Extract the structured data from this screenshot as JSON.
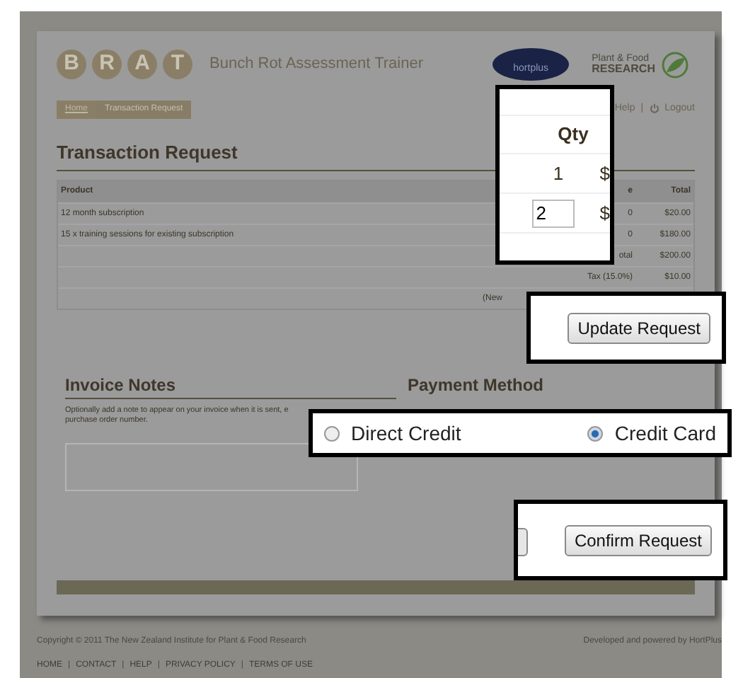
{
  "header": {
    "logo_letters": [
      "B",
      "R",
      "A",
      "T"
    ],
    "tagline": "Bunch Rot Assessment Trainer",
    "partner_logo": "hortplus",
    "partner_name": "Plant & Food",
    "partner_name_2": "RESEARCH"
  },
  "breadcrumb": [
    {
      "label": "Home",
      "selected": false
    },
    {
      "label": "Transaction Request",
      "selected": true
    }
  ],
  "user_links": [
    "Help",
    "Logout"
  ],
  "user_link_separator": "|",
  "title": "Transaction Request",
  "table": {
    "columns": [
      "Product",
      "e",
      "Total"
    ],
    "rows": [
      [
        "12 month subscription",
        "0",
        "$20.00"
      ],
      [
        "15 x training sessions for existing subscription",
        "0",
        "$180.00"
      ]
    ],
    "summary": [
      [
        "otal",
        "$200.00"
      ],
      [
        "Tax (15.0%)",
        "$10.00"
      ]
    ],
    "note": "(New"
  },
  "invoice_notes": {
    "title": "Invoice Notes",
    "hint_lines": [
      "Optionally add a note to appear on your invoice when it is sent, e",
      "purchase order number."
    ]
  },
  "payment_method": {
    "title": "Payment Method"
  },
  "qty_callout": {
    "header": "Qty",
    "values": [
      {
        "kind": "text",
        "value": "1",
        "edge": "$"
      },
      {
        "kind": "input",
        "value": "2",
        "edge": "$"
      }
    ]
  },
  "update_button": "Update Request",
  "payment_callout": {
    "options": [
      {
        "label": "Direct Credit",
        "selected": false
      },
      {
        "label": "Credit Card",
        "selected": true
      }
    ]
  },
  "confirm_button": "Confirm Request",
  "footer": {
    "copyright": "Copyright © 2011 The New Zealand Institute for Plant & Food Research",
    "credit": "Developed and powered by HortPlus",
    "links": [
      "HOME",
      "CONTACT",
      "HELP",
      "PRIVACY POLICY",
      "TERMS OF USE"
    ],
    "separator": "|"
  }
}
